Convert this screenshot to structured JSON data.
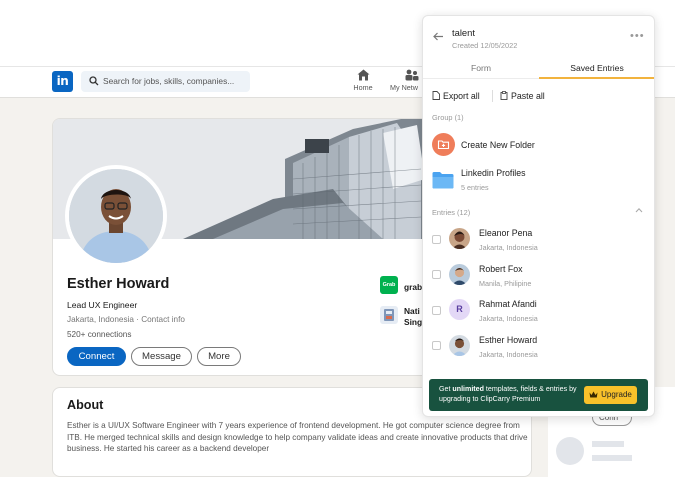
{
  "linkedin": {
    "search_placeholder": "Search for jobs, skills, companies...",
    "nav": [
      {
        "label": "Home",
        "icon": "home-icon"
      },
      {
        "label": "My Netw",
        "icon": "network-icon"
      }
    ]
  },
  "profile": {
    "name": "Esther Howard",
    "title": "Lead UX Engineer",
    "location": "Jakarta, Indonesia",
    "contact": "Contact info",
    "connections": "520+ connections",
    "buttons": {
      "connect": "Connect",
      "message": "Message",
      "more": "More"
    },
    "experience": [
      {
        "logo_text": "Grab",
        "name": "grab"
      },
      {
        "logo_text": "",
        "name": "Nati",
        "name2": "Sing"
      }
    ]
  },
  "about": {
    "title": "About",
    "text": "Esther is a UI/UX Software Engineer with 7 years experience of frontend development. He got computer science degree from ITB. He merged technical skills and design knowledge to help company validate ideas and create innovative products that drive business. He started his career as a backend developer"
  },
  "right_col": {
    "pill": "Conn"
  },
  "panel": {
    "title": "talent",
    "created": "Created 12/05/2022",
    "tabs": [
      {
        "label": "Form",
        "active": false
      },
      {
        "label": "Saved Entries",
        "active": true
      }
    ],
    "actions": {
      "export": "Export all",
      "paste": "Paste all"
    },
    "group_label": "Group (1)",
    "create_folder": "Create New Folder",
    "folder": {
      "name": "Linkedin Profiles",
      "count": "5 entries"
    },
    "entries_label": "Entries (12)",
    "entries": [
      {
        "name": "Eleanor Pena",
        "location": "Jakarta, Indonesia"
      },
      {
        "name": "Robert Fox",
        "location": "Manila, Philipine"
      },
      {
        "name": "Rahmat Afandi",
        "location": "Jakarta, Indonesia",
        "initial": "R"
      },
      {
        "name": "Esther Howard",
        "location": "Jakarta, Indonesia"
      }
    ],
    "upgrade": {
      "text_pre": "Get ",
      "text_bold": "unlimited",
      "text_post": " templates, fields & entries by upgrading to ClipCarry Premium",
      "button": "Upgrade"
    }
  },
  "colors": {
    "linkedin_blue": "#0a66c2",
    "accent_yellow": "#f2b33d",
    "upgrade_green": "#18523f",
    "folder_orange": "#ef7d5a",
    "folder_blue": "#4aa3f0"
  }
}
